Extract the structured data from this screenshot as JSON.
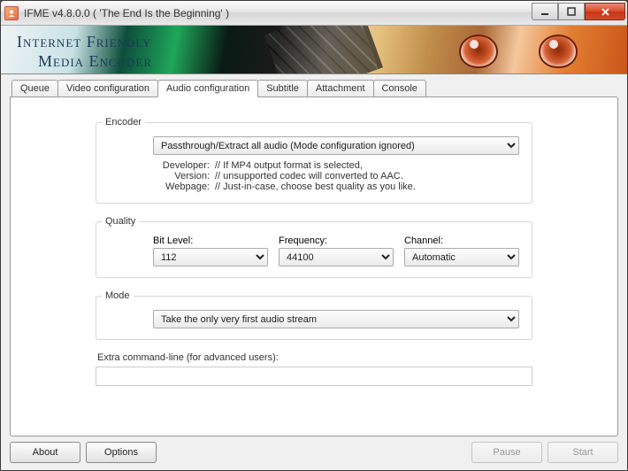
{
  "window": {
    "title": "IFME v4.8.0.0 ( 'The End Is the Beginning' )"
  },
  "banner": {
    "line1": "Internet Friendly",
    "line2": "Media Encoder"
  },
  "tabs": [
    {
      "label": "Queue"
    },
    {
      "label": "Video configuration"
    },
    {
      "label": "Audio configuration"
    },
    {
      "label": "Subtitle"
    },
    {
      "label": "Attachment"
    },
    {
      "label": "Console"
    }
  ],
  "encoder": {
    "legend": "Encoder",
    "selected": "Passthrough/Extract all audio (Mode configuration ignored)",
    "dev_label": "Developer:",
    "ver_label": "Version:",
    "web_label": "Webpage:",
    "dev_value": "// If MP4 output format is selected,",
    "ver_value": "// unsupported codec will converted to AAC.",
    "web_value": "// Just-in-case, choose best quality as you like."
  },
  "quality": {
    "legend": "Quality",
    "bit_label": "Bit Level:",
    "bit_value": "112",
    "freq_label": "Frequency:",
    "freq_value": "44100",
    "chan_label": "Channel:",
    "chan_value": "Automatic"
  },
  "mode": {
    "legend": "Mode",
    "selected": "Take the only very first audio stream"
  },
  "extra": {
    "label": "Extra command-line (for advanced users):",
    "value": ""
  },
  "buttons": {
    "about": "About",
    "options": "Options",
    "pause": "Pause",
    "start": "Start"
  }
}
